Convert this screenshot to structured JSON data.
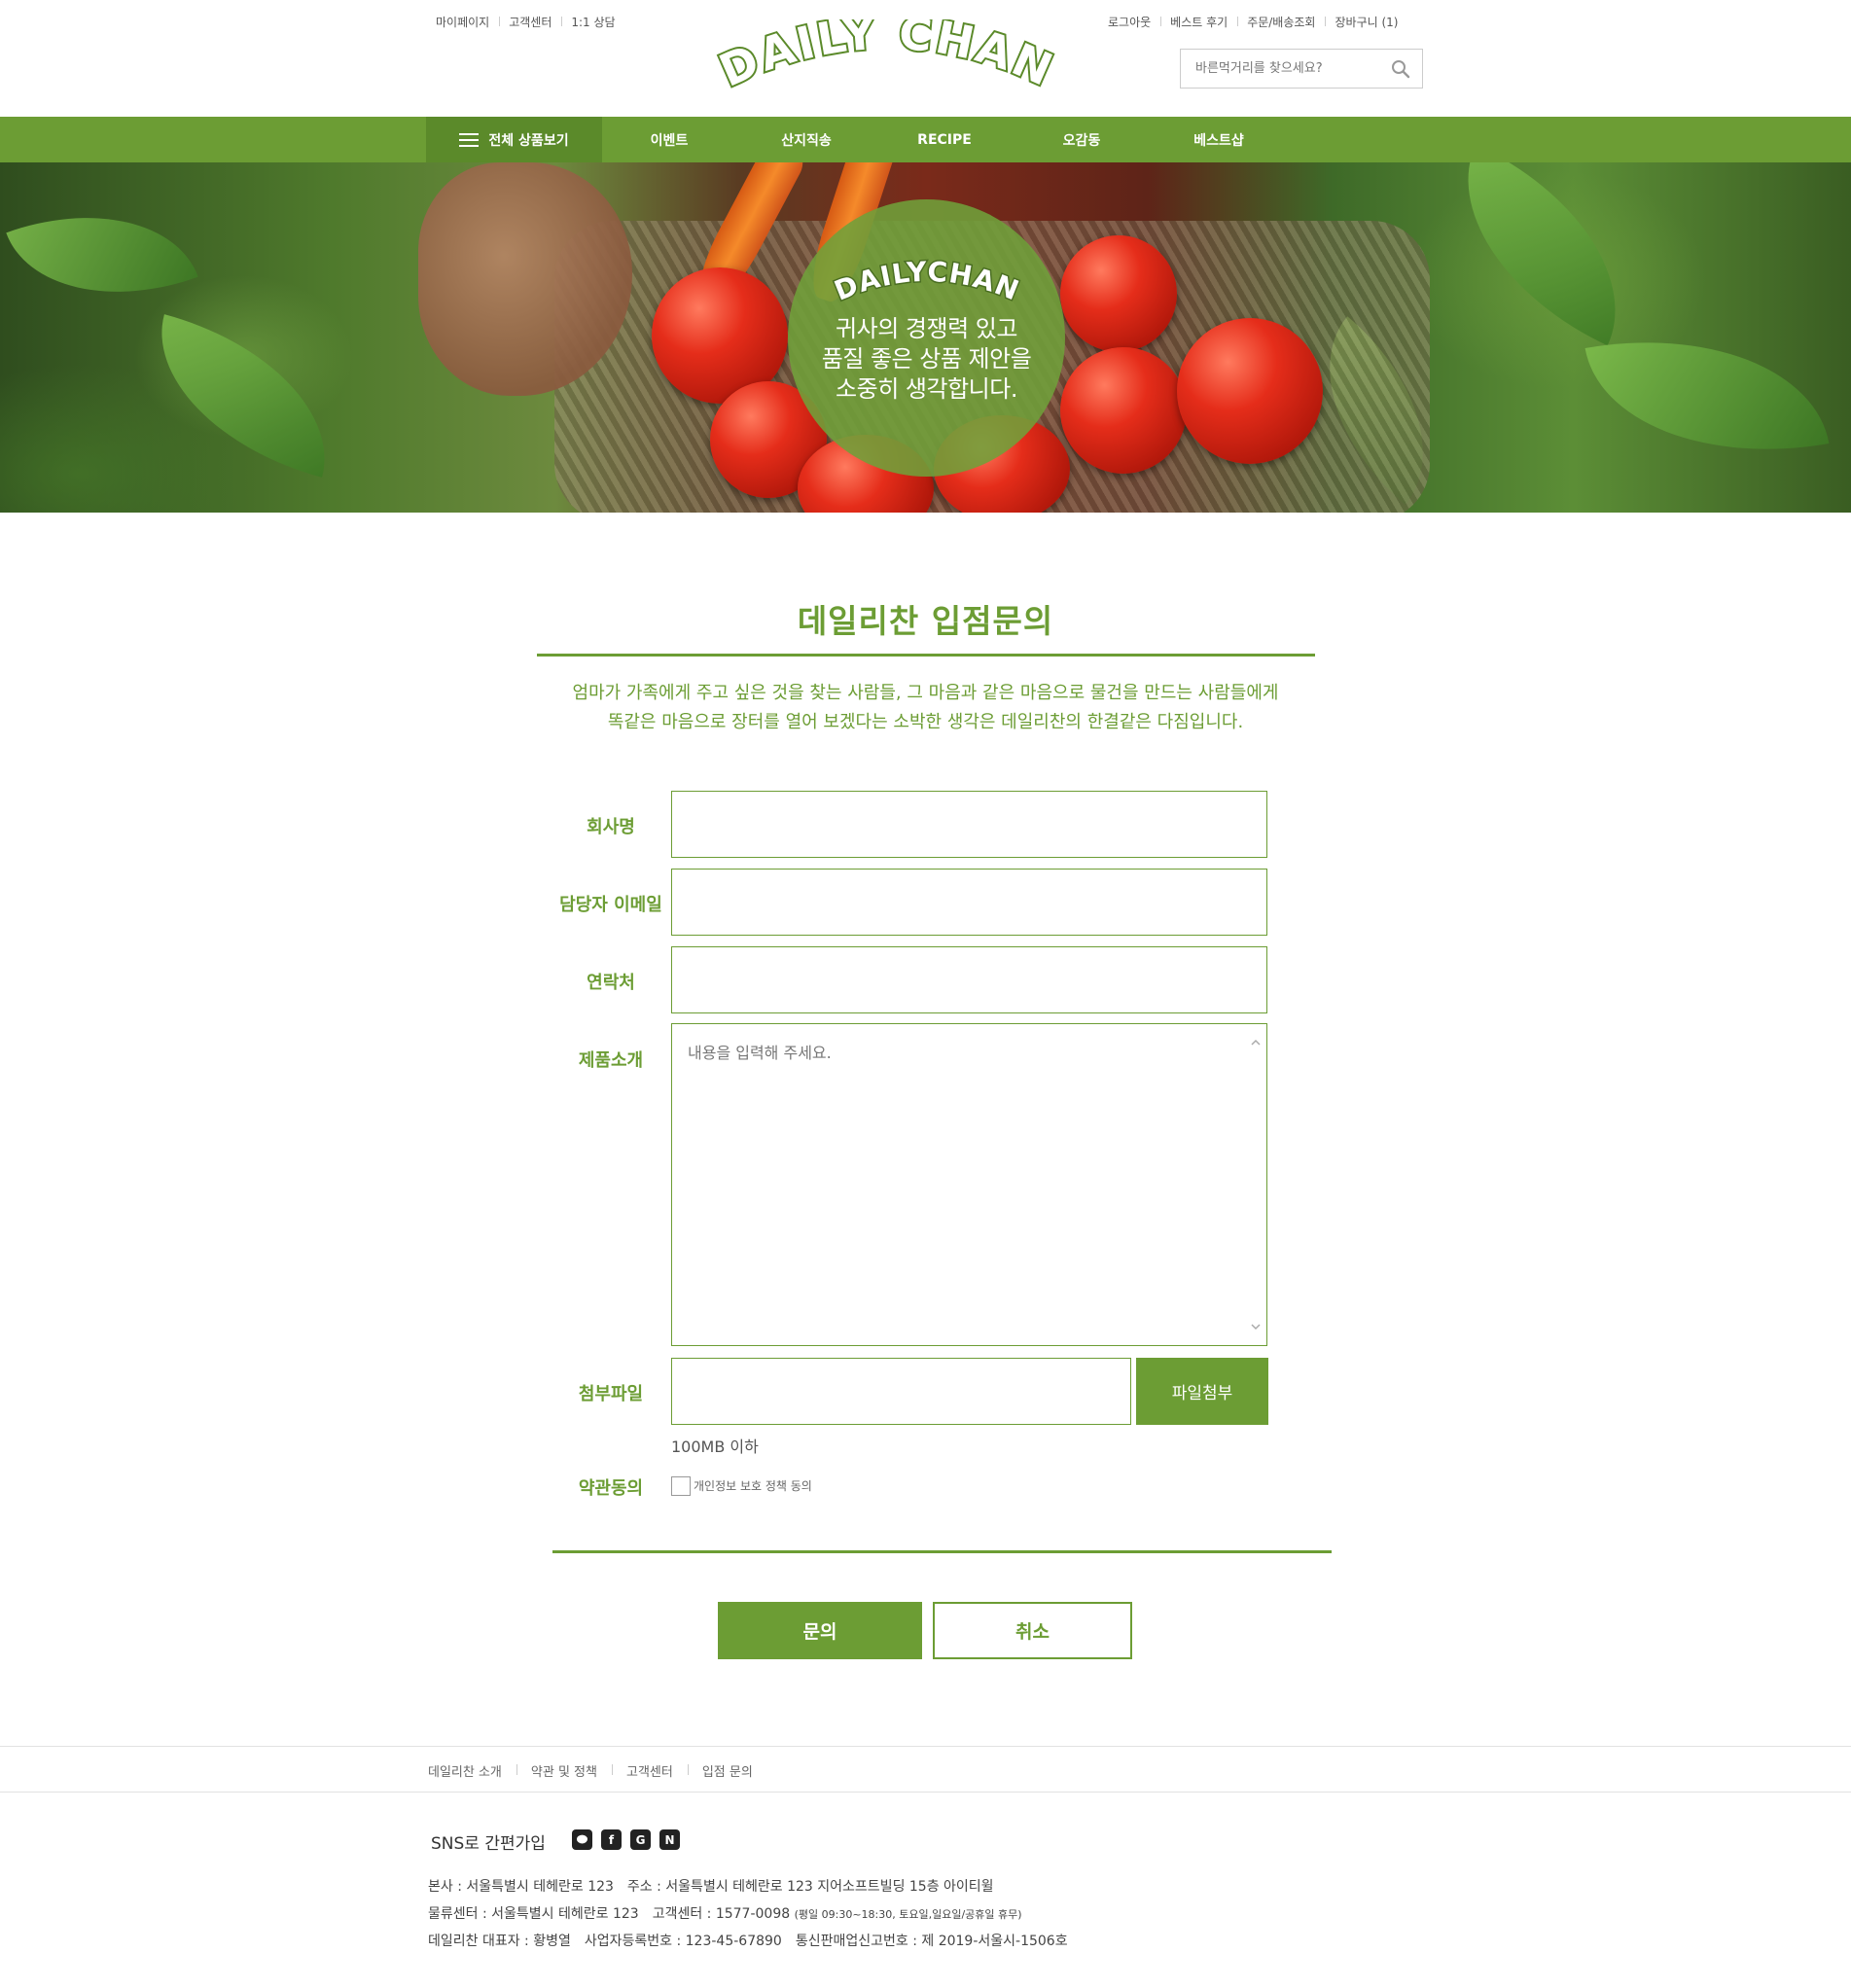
{
  "header": {
    "util_left": [
      "마이페이지",
      "고객센터",
      "1:1 상담"
    ],
    "util_right": [
      "로그아웃",
      "베스트 후기",
      "주문/배송조회",
      "장바구니 (1)"
    ],
    "logo_text": "DAILY CHAN",
    "search_placeholder": "바른먹거리를 찾으세요?"
  },
  "nav": {
    "all_label": "전체 상품보기",
    "items": [
      "이벤트",
      "산지직송",
      "RECIPE",
      "오감동",
      "베스트샵"
    ]
  },
  "hero": {
    "logo_text": "DAILYCHAN",
    "lines": [
      "귀사의 경쟁력 있고",
      "품질 좋은 상품 제안을",
      "소중히 생각합니다."
    ]
  },
  "page": {
    "title": "데일리찬 입점문의",
    "intro_lines": [
      "엄마가 가족에게 주고 싶은 것을 찾는 사람들, 그 마음과 같은 마음으로 물건을 만드는 사람들에게",
      "똑같은 마음으로 장터를 열어 보겠다는 소박한 생각은 데일리찬의 한결같은 다짐입니다."
    ]
  },
  "form": {
    "company_label": "회사명",
    "email_label": "담당자 이메일",
    "contact_label": "연락처",
    "product_label": "제품소개",
    "product_placeholder": "내용을 입력해 주세요.",
    "file_label": "첨부파일",
    "file_button": "파일첨부",
    "file_hint": "100MB 이하",
    "agree_label": "약관동의",
    "agree_text": "개인정보 보호 정책 동의",
    "submit": "문의",
    "cancel": "취소"
  },
  "footer": {
    "links": [
      "데일리찬 소개",
      "약관 및 정책",
      "고객센터",
      "입점 문의"
    ],
    "sns_title": "SNS로 간편가입",
    "sns_icons": [
      "talk-icon",
      "facebook-icon",
      "google-icon",
      "naver-icon"
    ],
    "sns_letters": [
      "",
      "f",
      "G",
      "N"
    ],
    "hq": "본사 : 서울특별시 테헤란로 123",
    "address": "주소 : 서울특별시 테헤란로 123 지어소프트빌딩 15층 아이티윌",
    "logistics": "물류센터 : 서울특별시 테헤란로 123",
    "cs": "고객센터 : 1577-0098",
    "cs_hours": "(평일 09:30~18:30, 토요일,일요일/공휴일 휴무)",
    "ceo": "데일리찬 대표자 : 황병열",
    "biz_no": "사업자등록번호 : 123-45-67890",
    "mail_order": "통신판매업신고번호 : 제 2019-서울시-1506호"
  },
  "colors": {
    "brand_green": "#6c9d34",
    "brand_green_dark": "#5b8a2a"
  }
}
